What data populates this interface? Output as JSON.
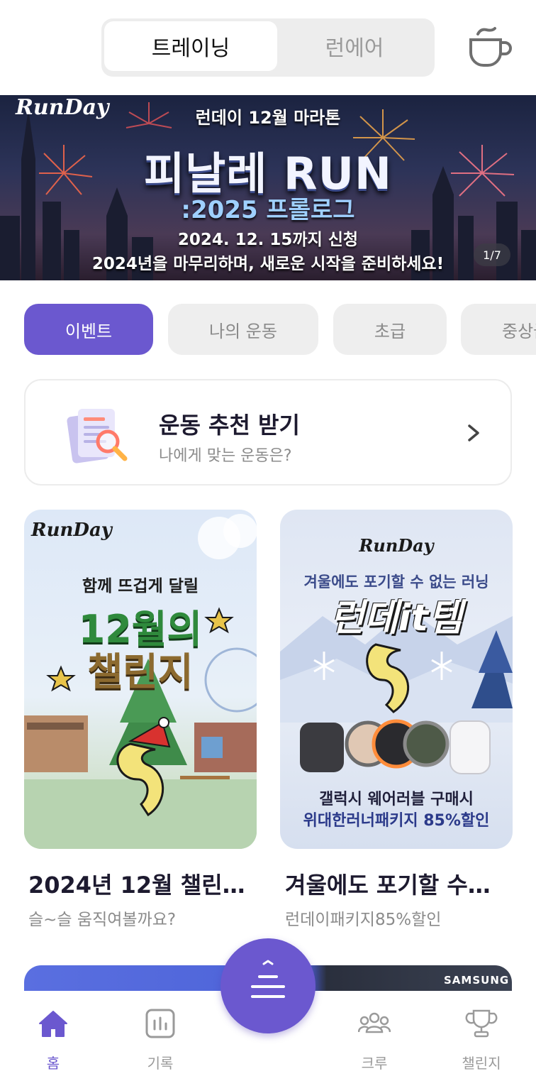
{
  "header": {
    "tabs": [
      {
        "label": "트레이닝",
        "active": true
      },
      {
        "label": "런에어",
        "active": false
      }
    ],
    "cup_icon": "coffee-cup-icon"
  },
  "hero_banner": {
    "brand": "RunDay",
    "subtitle": "런데이 12월 마라톤",
    "title": "피날레 RUN",
    "year_line": ":2025 프롤로그",
    "deadline": "2024. 12. 15까지 신청",
    "description": "2024년을 마무리하며, 새로운 시작을 준비하세요!",
    "pager": "1/7"
  },
  "filters": [
    {
      "label": "이벤트",
      "active": true
    },
    {
      "label": "나의 운동",
      "active": false
    },
    {
      "label": "초급",
      "active": false
    },
    {
      "label": "중상급",
      "active": false
    }
  ],
  "recommend_card": {
    "title": "운동 추천 받기",
    "subtitle": "나에게 맞는 운동은?"
  },
  "event_cards": [
    {
      "image": {
        "brand": "RunDay",
        "tagline": "함께 뜨겁게 달릴",
        "headline_1": "12월의",
        "headline_2": "챌린지"
      },
      "title": "2024년 12월 챌린…",
      "subtitle": "슬~슬 움직여볼까요?"
    },
    {
      "image": {
        "brand": "RunDay",
        "tagline": "겨울에도 포기할 수 없는 러닝",
        "headline": "런데it템",
        "line_1": "갤럭시 웨어러블 구매시",
        "line_2": "위대한러너패키지 85%할인"
      },
      "title": "겨울에도 포기할 수…",
      "subtitle": "런데이패키지85%할인"
    }
  ],
  "peek_banner": {
    "brand": "SAMSUNG"
  },
  "bottom_nav": [
    {
      "label": "홈",
      "icon": "home-icon",
      "active": true
    },
    {
      "label": "기록",
      "icon": "chart-box-icon",
      "active": false
    },
    {
      "label": "크루",
      "icon": "group-icon",
      "active": false
    },
    {
      "label": "챌린지",
      "icon": "trophy-icon",
      "active": false
    }
  ],
  "colors": {
    "accent": "#6b58cf",
    "chip_bg": "#eeeeee",
    "muted_text": "#8b8b8b"
  }
}
